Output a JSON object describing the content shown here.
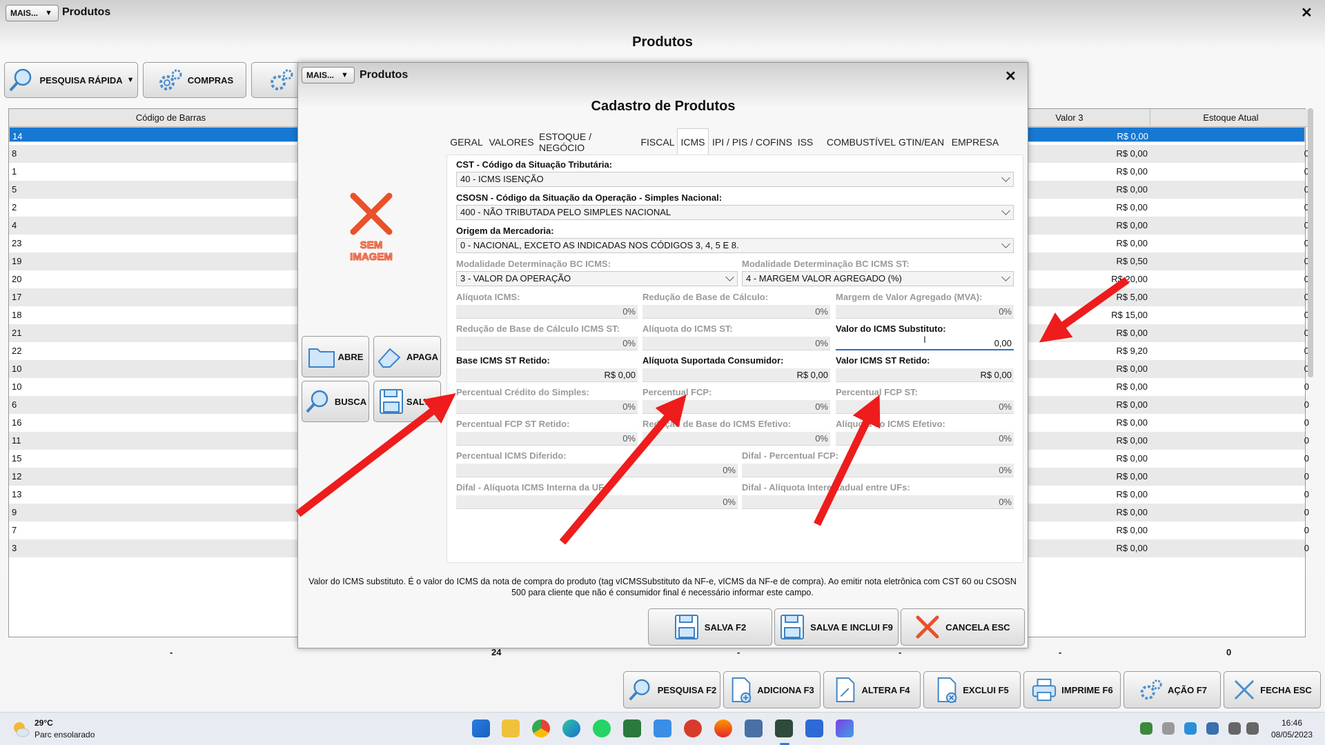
{
  "main": {
    "mais_label": "MAIS...",
    "window_title": "Produtos",
    "close_symbol": "✕",
    "page_title": "Produtos",
    "toolbar": {
      "pesquisa_rapida": "PESQUISA RÁPIDA",
      "compras": "COMPRAS"
    },
    "grid": {
      "headers": [
        "Código de Barras",
        "Valor 3",
        "Estoque Atual"
      ],
      "rows": [
        {
          "codigo": "14",
          "valor3": "R$ 0,00",
          "estoque": "0"
        },
        {
          "codigo": "8",
          "valor3": "R$ 0,00",
          "estoque": "0"
        },
        {
          "codigo": "1",
          "valor3": "R$ 0,00",
          "estoque": "0"
        },
        {
          "codigo": "5",
          "valor3": "R$ 0,00",
          "estoque": "0"
        },
        {
          "codigo": "2",
          "valor3": "R$ 0,00",
          "estoque": "0"
        },
        {
          "codigo": "4",
          "valor3": "R$ 0,00",
          "estoque": "0"
        },
        {
          "codigo": "23",
          "valor3": "R$ 0,00",
          "estoque": "0"
        },
        {
          "codigo": "19",
          "valor3": "R$ 0,50",
          "estoque": "0"
        },
        {
          "codigo": "20",
          "valor3": "R$ 20,00",
          "estoque": "0"
        },
        {
          "codigo": "17",
          "valor3": "R$ 5,00",
          "estoque": "0"
        },
        {
          "codigo": "18",
          "valor3": "R$ 15,00",
          "estoque": "0"
        },
        {
          "codigo": "21",
          "valor3": "R$ 0,00",
          "estoque": "0"
        },
        {
          "codigo": "22",
          "valor3": "R$ 9,20",
          "estoque": "0"
        },
        {
          "codigo": "10",
          "valor3": "R$ 0,00",
          "estoque": "0"
        },
        {
          "codigo": "10",
          "valor3": "R$ 0,00",
          "estoque": "0"
        },
        {
          "codigo": "6",
          "valor3": "R$ 0,00",
          "estoque": "0"
        },
        {
          "codigo": "16",
          "valor3": "R$ 0,00",
          "estoque": "0"
        },
        {
          "codigo": "11",
          "valor3": "R$ 0,00",
          "estoque": "0"
        },
        {
          "codigo": "15",
          "valor3": "R$ 0,00",
          "estoque": "0"
        },
        {
          "codigo": "12",
          "valor3": "R$ 0,00",
          "estoque": "0"
        },
        {
          "codigo": "13",
          "valor3": "R$ 0,00",
          "estoque": "0"
        },
        {
          "codigo": "9",
          "valor3": "R$ 0,00",
          "estoque": "0"
        },
        {
          "codigo": "7",
          "valor3": "R$ 0,00",
          "estoque": "0"
        },
        {
          "codigo": "3",
          "valor3": "R$ 0,00",
          "estoque": "0"
        }
      ],
      "footer": [
        "-",
        "24",
        "-",
        "-",
        "-",
        "0"
      ]
    },
    "bottom_buttons": {
      "pesquisa": "PESQUISA F2",
      "adiciona": "ADICIONA F3",
      "altera": "ALTERA F4",
      "exclui": "EXCLUI F5",
      "imprime": "IMPRIME F6",
      "acao": "AÇÃO F7",
      "fecha": "FECHA ESC"
    }
  },
  "dialog": {
    "mais_label": "MAIS...",
    "window_title": "Produtos",
    "close_symbol": "✕",
    "title": "Cadastro de Produtos",
    "no_image_line1": "SEM",
    "no_image_line2": "IMAGEM",
    "side_buttons": {
      "abre": "ABRE",
      "apaga": "APAGA",
      "busca": "BUSCA",
      "salva": "SALVA"
    },
    "tabs": [
      "GERAL",
      "VALORES",
      "ESTOQUE / NEGÓCIO",
      "FISCAL",
      "ICMS",
      "IPI / PIS / COFINS",
      "ISS",
      "COMBUSTÍVEL",
      "GTIN/EAN",
      "EMPRESA"
    ],
    "active_tab": "ICMS",
    "fields": {
      "cst_label": "CST - Código da Situação Tributária:",
      "cst_value": "40 - ICMS ISENÇÃO",
      "csosn_label": "CSOSN - Código da Situação da Operação - Simples Nacional:",
      "csosn_value": "400 - NÃO TRIBUTADA PELO SIMPLES NACIONAL",
      "origem_label": "Origem da Mercadoria:",
      "origem_value": "0 - NACIONAL, EXCETO AS INDICADAS NOS CÓDIGOS 3, 4, 5 E 8.",
      "mod_bc_label": "Modalidade Determinação BC ICMS:",
      "mod_bc_value": "3 - VALOR DA OPERAÇÃO",
      "mod_bc_st_label": "Modalidade Determinação BC ICMS ST:",
      "mod_bc_st_value": "4 - MARGEM VALOR AGREGADO (%)",
      "aliq_icms_label": "Alíquota ICMS:",
      "aliq_icms_value": "0%",
      "red_bc_label": "Redução de Base de Cálculo:",
      "red_bc_value": "0%",
      "mva_label": "Margem de Valor Agregado (MVA):",
      "mva_value": "0%",
      "red_bc_st_label": "Redução de Base de Cálculo ICMS ST:",
      "red_bc_st_value": "0%",
      "aliq_st_label": "Alíquota do ICMS ST:",
      "aliq_st_value": "0%",
      "valor_subst_label": "Valor do ICMS Substituto:",
      "valor_subst_value": "0,00",
      "base_st_retido_label": "Base ICMS ST Retido:",
      "base_st_retido_value": "R$ 0,00",
      "aliq_consumidor_label": "Alíquota Suportada Consumidor:",
      "aliq_consumidor_value": "R$ 0,00",
      "valor_st_retido_label": "Valor ICMS ST Retido:",
      "valor_st_retido_value": "R$ 0,00",
      "perc_credito_label": "Percentual Crédito do Simples:",
      "perc_credito_value": "0%",
      "perc_fcp_label": "Percentual FCP:",
      "perc_fcp_value": "0%",
      "perc_fcp_st_label": "Percentual FCP ST:",
      "perc_fcp_st_value": "0%",
      "perc_fcp_st_ret_label": "Percentual FCP ST Retido:",
      "perc_fcp_st_ret_value": "0%",
      "red_bc_efetivo_label": "Redução de Base do ICMS Efetivo:",
      "red_bc_efetivo_value": "0%",
      "aliq_efetivo_label": "Alíquota do ICMS Efetivo:",
      "aliq_efetivo_value": "0%",
      "perc_diferido_label": "Percentual ICMS Diferido:",
      "perc_diferido_value": "0%",
      "difal_fcp_label": "Difal - Percentual FCP:",
      "difal_fcp_value": "0%",
      "difal_interna_label": "Difal - Alíquota ICMS Interna da UF:",
      "difal_interna_value": "0%",
      "difal_inter_label": "Difal - Alíquota Interestadual entre UFs:",
      "difal_inter_value": "0%"
    },
    "hint": "Valor do ICMS substituto. É o valor do ICMS da nota de compra do produto (tag vICMSSubstituto da NF-e, vICMS da NF-e de compra). Ao emitir nota eletrônica com CST 60 ou CSOSN 500 para cliente que não é consumidor final é necessário informar este campo.",
    "buttons": {
      "salva": "SALVA F2",
      "salva_inclui": "SALVA E INCLUI F9",
      "cancela": "CANCELA ESC"
    }
  },
  "taskbar": {
    "weather_temp": "29°C",
    "weather_desc": "Parc ensolarado",
    "time": "16:46",
    "date": "08/05/2023"
  },
  "colors": {
    "accent_blue": "#1778d2",
    "annotation_red": "#ee1c1c",
    "no_image_red": "#e8512a"
  }
}
